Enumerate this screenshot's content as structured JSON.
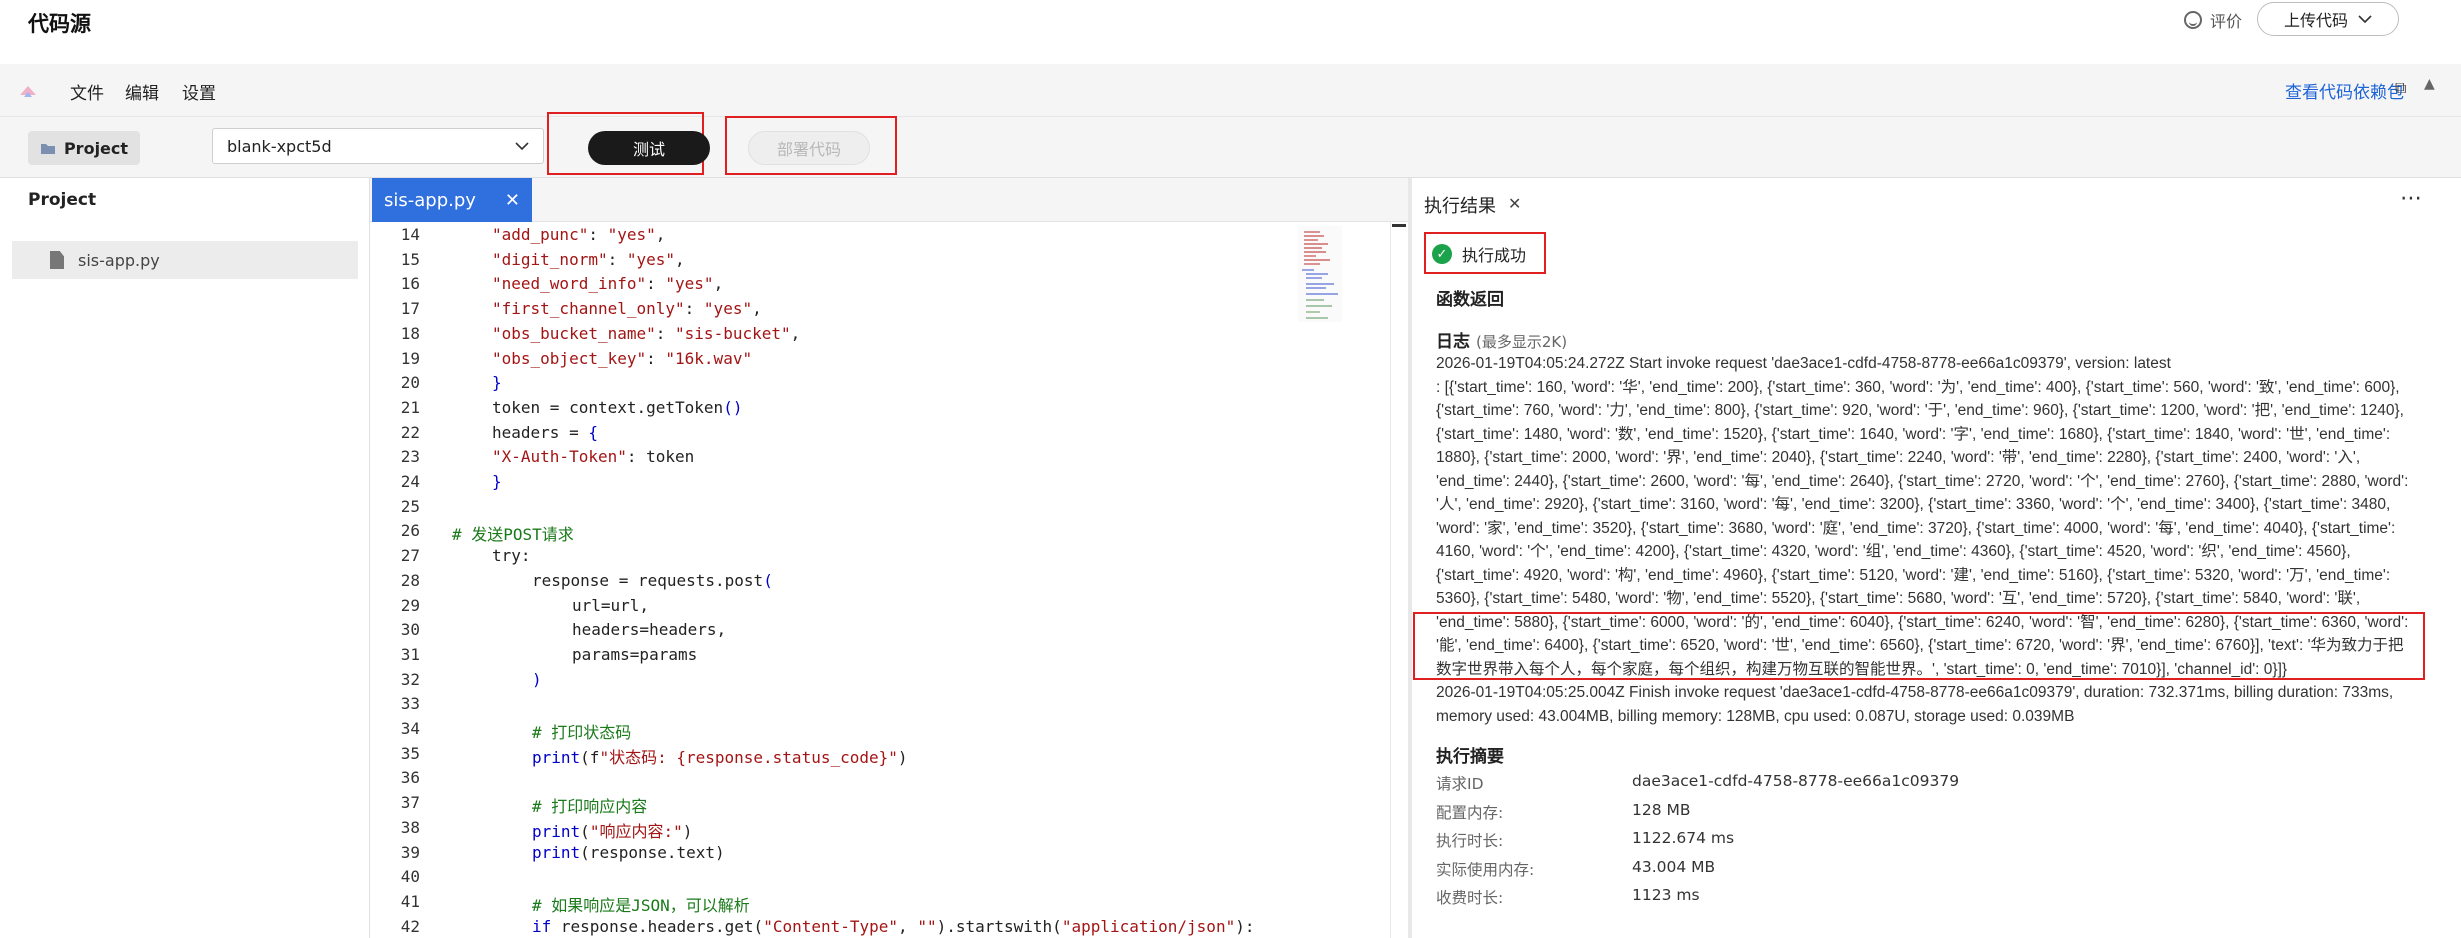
{
  "header": {
    "title": "代码源",
    "rate_label": "评价",
    "upload_label": "上传代码"
  },
  "menu": {
    "items": [
      "文件",
      "编辑",
      "设置"
    ],
    "deps_link": "查看代码依赖包"
  },
  "toolbar": {
    "project_label": "Project",
    "function_select_value": "blank-xpct5d",
    "test_label": "测试",
    "deploy_label": "部署代码"
  },
  "left_panel": {
    "title": "Project",
    "files": [
      "sis-app.py"
    ]
  },
  "editor": {
    "tab_label": "sis-app.py",
    "lines": [
      {
        "n": "14",
        "indent": 1,
        "tokens": [
          [
            "str",
            "\"add_punc\""
          ],
          [
            "pl",
            ": "
          ],
          [
            "str",
            "\"yes\""
          ],
          [
            "pl",
            ","
          ]
        ]
      },
      {
        "n": "15",
        "indent": 1,
        "tokens": [
          [
            "str",
            "\"digit_norm\""
          ],
          [
            "pl",
            ": "
          ],
          [
            "str",
            "\"yes\""
          ],
          [
            "pl",
            ","
          ]
        ]
      },
      {
        "n": "16",
        "indent": 1,
        "tokens": [
          [
            "str",
            "\"need_word_info\""
          ],
          [
            "pl",
            ": "
          ],
          [
            "str",
            "\"yes\""
          ],
          [
            "pl",
            ","
          ]
        ]
      },
      {
        "n": "17",
        "indent": 1,
        "tokens": [
          [
            "str",
            "\"first_channel_only\""
          ],
          [
            "pl",
            ": "
          ],
          [
            "str",
            "\"yes\""
          ],
          [
            "pl",
            ","
          ]
        ]
      },
      {
        "n": "18",
        "indent": 1,
        "tokens": [
          [
            "str",
            "\"obs_bucket_name\""
          ],
          [
            "pl",
            ": "
          ],
          [
            "str",
            "\"sis-bucket\""
          ],
          [
            "pl",
            ","
          ]
        ]
      },
      {
        "n": "19",
        "indent": 1,
        "tokens": [
          [
            "str",
            "\"obs_object_key\""
          ],
          [
            "pl",
            ": "
          ],
          [
            "str",
            "\"16k.wav\""
          ]
        ]
      },
      {
        "n": "20",
        "indent": 1,
        "tokens": [
          [
            "kw",
            "}"
          ]
        ]
      },
      {
        "n": "21",
        "indent": 1,
        "tokens": [
          [
            "pl",
            "token = context.getToken"
          ],
          [
            "kw",
            "()"
          ]
        ]
      },
      {
        "n": "22",
        "indent": 1,
        "tokens": [
          [
            "pl",
            "headers = "
          ],
          [
            "kw",
            "{"
          ]
        ]
      },
      {
        "n": "23",
        "indent": 1,
        "tokens": [
          [
            "str",
            "\"X-Auth-Token\""
          ],
          [
            "pl",
            ": token"
          ]
        ]
      },
      {
        "n": "24",
        "indent": 1,
        "tokens": [
          [
            "kw",
            "}"
          ]
        ]
      },
      {
        "n": "25",
        "indent": 0,
        "tokens": []
      },
      {
        "n": "26",
        "indent": 0,
        "tokens": [
          [
            "cm",
            "# 发送POST请求"
          ]
        ]
      },
      {
        "n": "27",
        "indent": 1,
        "tokens": [
          [
            "pl",
            "try:"
          ]
        ]
      },
      {
        "n": "28",
        "indent": 2,
        "tokens": [
          [
            "pl",
            "response = requests.post"
          ],
          [
            "kw",
            "("
          ]
        ]
      },
      {
        "n": "29",
        "indent": 3,
        "tokens": [
          [
            "pl",
            "url=url,"
          ]
        ]
      },
      {
        "n": "30",
        "indent": 3,
        "tokens": [
          [
            "pl",
            "headers=headers,"
          ]
        ]
      },
      {
        "n": "31",
        "indent": 3,
        "tokens": [
          [
            "pl",
            "params=params"
          ]
        ]
      },
      {
        "n": "32",
        "indent": 2,
        "tokens": [
          [
            "kw",
            ")"
          ]
        ]
      },
      {
        "n": "33",
        "indent": 0,
        "tokens": []
      },
      {
        "n": "34",
        "indent": 2,
        "tokens": [
          [
            "cm",
            "# 打印状态码"
          ]
        ]
      },
      {
        "n": "35",
        "indent": 2,
        "tokens": [
          [
            "kw",
            "print"
          ],
          [
            "pl",
            "(f"
          ],
          [
            "str",
            "\"状态码: {response.status_code}\""
          ],
          [
            "pl",
            ")"
          ]
        ]
      },
      {
        "n": "36",
        "indent": 0,
        "tokens": []
      },
      {
        "n": "37",
        "indent": 2,
        "tokens": [
          [
            "cm",
            "# 打印响应内容"
          ]
        ]
      },
      {
        "n": "38",
        "indent": 2,
        "tokens": [
          [
            "kw",
            "print"
          ],
          [
            "pl",
            "("
          ],
          [
            "str",
            "\"响应内容:\""
          ],
          [
            "pl",
            ")"
          ]
        ]
      },
      {
        "n": "39",
        "indent": 2,
        "tokens": [
          [
            "kw",
            "print"
          ],
          [
            "pl",
            "(response.text)"
          ]
        ]
      },
      {
        "n": "40",
        "indent": 0,
        "tokens": []
      },
      {
        "n": "41",
        "indent": 2,
        "tokens": [
          [
            "cm",
            "# 如果响应是JSON，可以解析"
          ]
        ]
      },
      {
        "n": "42",
        "indent": 2,
        "tokens": [
          [
            "kw",
            "if"
          ],
          [
            "pl",
            " response.headers.get("
          ],
          [
            "str",
            "\"Content-Type\""
          ],
          [
            "pl",
            ", "
          ],
          [
            "str",
            "\"\""
          ],
          [
            "pl",
            ").startswith("
          ],
          [
            "str",
            "\"application/json\""
          ],
          [
            "pl",
            "):"
          ]
        ]
      }
    ]
  },
  "result": {
    "tab_label": "执行结果",
    "status": "执行成功",
    "func_return_title": "函数返回",
    "log_title": "日志",
    "log_hint": "(最多显示2K)",
    "log_lines": [
      "2026-01-19T04:05:24.272Z Start invoke request 'dae3ace1-cdfd-4758-8778-ee66a1c09379', version: latest",
      ": [{'start_time': 160, 'word': '华', 'end_time': 200}, {'start_time': 360, 'word': '为', 'end_time': 400}, {'start_time': 560, 'word': '致', 'end_time': 600},",
      "{'start_time': 760, 'word': '力', 'end_time': 800}, {'start_time': 920, 'word': '于', 'end_time': 960}, {'start_time': 1200, 'word': '把', 'end_time': 1240},",
      "{'start_time': 1480, 'word': '数', 'end_time': 1520}, {'start_time': 1640, 'word': '字', 'end_time': 1680}, {'start_time': 1840, 'word': '世', 'end_time':",
      "1880}, {'start_time': 2000, 'word': '界', 'end_time': 2040}, {'start_time': 2240, 'word': '带', 'end_time': 2280}, {'start_time': 2400, 'word': '入',",
      "'end_time': 2440}, {'start_time': 2600, 'word': '每', 'end_time': 2640}, {'start_time': 2720, 'word': '个', 'end_time': 2760}, {'start_time': 2880, 'word':",
      "'人', 'end_time': 2920}, {'start_time': 3160, 'word': '每', 'end_time': 3200}, {'start_time': 3360, 'word': '个', 'end_time': 3400}, {'start_time': 3480,",
      "'word': '家', 'end_time': 3520}, {'start_time': 3680, 'word': '庭', 'end_time': 3720}, {'start_time': 4000, 'word': '每', 'end_time': 4040}, {'start_time':",
      "4160, 'word': '个', 'end_time': 4200}, {'start_time': 4320, 'word': '组', 'end_time': 4360}, {'start_time': 4520, 'word': '织', 'end_time': 4560},",
      "{'start_time': 4920, 'word': '构', 'end_time': 4960}, {'start_time': 5120, 'word': '建', 'end_time': 5160}, {'start_time': 5320, 'word': '万', 'end_time':",
      "5360}, {'start_time': 5480, 'word': '物', 'end_time': 5520}, {'start_time': 5680, 'word': '互', 'end_time': 5720}, {'start_time': 5840, 'word': '联',",
      "'end_time': 5880}, {'start_time': 6000, 'word': '的', 'end_time': 6040}, {'start_time': 6240, 'word': '智', 'end_time': 6280}, {'start_time': 6360, 'word':",
      "'能', 'end_time': 6400}, {'start_time': 6520, 'word': '世', 'end_time': 6560}, {'start_time': 6720, 'word': '界', 'end_time': 6760}], 'text': '华为致力于把",
      "数字世界带入每个人，每个家庭，每个组织，构建万物互联的智能世界。', 'start_time': 0, 'end_time': 7010}], 'channel_id': 0}]}",
      "2026-01-19T04:05:25.004Z Finish invoke request 'dae3ace1-cdfd-4758-8778-ee66a1c09379', duration: 732.371ms, billing duration: 733ms,",
      "memory used: 43.004MB, billing memory: 128MB, cpu used: 0.087U, storage used: 0.039MB"
    ],
    "summary_title": "执行摘要",
    "summary": [
      {
        "k": "请求ID",
        "v": "dae3ace1-cdfd-4758-8778-ee66a1c09379"
      },
      {
        "k": "配置内存:",
        "v": "128 MB"
      },
      {
        "k": "执行时长:",
        "v": "1122.674 ms"
      },
      {
        "k": "实际使用内存:",
        "v": "43.004 MB"
      },
      {
        "k": "收费时长:",
        "v": "1123 ms"
      }
    ]
  }
}
